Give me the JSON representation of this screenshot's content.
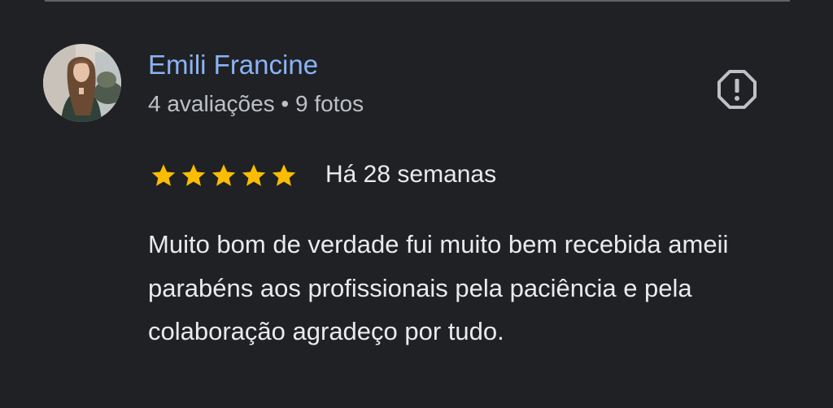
{
  "review": {
    "author_name": "Emili Francine",
    "author_meta": "4 avaliações • 9 fotos",
    "rating": 5,
    "rating_max": 5,
    "date": "Há 28 semanas",
    "text": "Muito bom de verdade fui muito bem recebida ameii parabéns aos profissionais pela paciência e pela colaboração agradeço por tudo."
  },
  "icons": {
    "report": "report-octagon-icon",
    "star": "star-icon"
  },
  "colors": {
    "background": "#202124",
    "author_name": "#8ab4f8",
    "star": "#fbbc04",
    "text": "#e8eaed",
    "meta": "#bdc1c6"
  }
}
